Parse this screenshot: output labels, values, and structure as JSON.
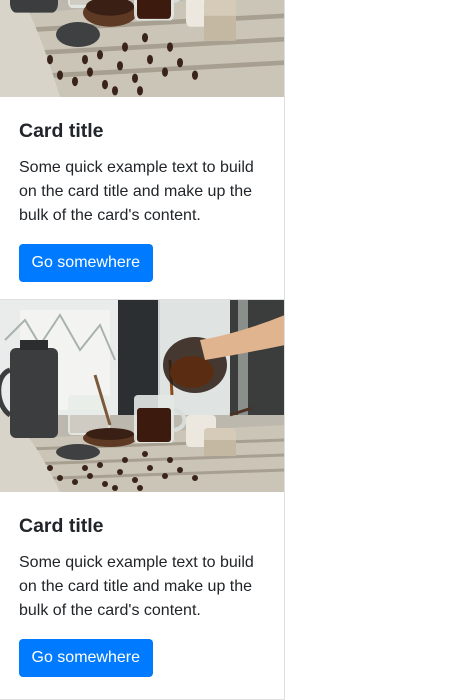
{
  "colors": {
    "accent": "#007bff",
    "text": "#212529",
    "border": "#dfdfdf"
  },
  "cards": [
    {
      "image_icon": "coffee-pour-photo",
      "title": "Card title",
      "text": "Some quick example text to build on the card title and make up the bulk of the card's content.",
      "button_label": "Go somewhere"
    },
    {
      "image_icon": "coffee-pour-photo",
      "title": "Card title",
      "text": "Some quick example text to build on the card title and make up the bulk of the card's content.",
      "button_label": "Go somewhere"
    }
  ]
}
